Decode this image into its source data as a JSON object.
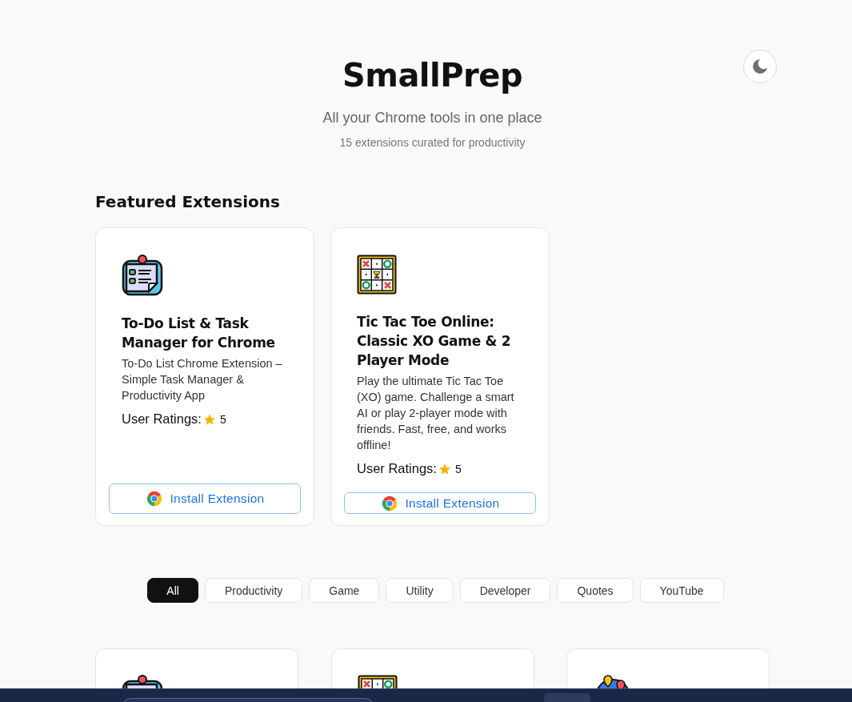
{
  "header": {
    "title": "SmallPrep",
    "subtitle": "All your Chrome tools in one place",
    "count": "15 extensions curated for productivity"
  },
  "featured": {
    "heading": "Featured Extensions",
    "cards": [
      {
        "kind": "todo",
        "title": "To-Do List & Task Manager for Chrome",
        "description": "To-Do List Chrome Extension – Simple Task Manager & Productivity App",
        "ratings_label": "User Ratings:",
        "rating": "5",
        "button": "Install Extension"
      },
      {
        "kind": "tictactoe",
        "title": "Tic Tac Toe Online: Classic XO Game & 2 Player Mode",
        "description": "Play the ultimate Tic Tac Toe (XO) game. Challenge a smart AI or play 2-player mode with friends. Fast, free, and works offline!",
        "ratings_label": "User Ratings:",
        "rating": "5",
        "button": "Install Extension"
      }
    ]
  },
  "filters": [
    {
      "label": "All",
      "selected": true
    },
    {
      "label": "Productivity",
      "selected": false
    },
    {
      "label": "Game",
      "selected": false
    },
    {
      "label": "Utility",
      "selected": false
    },
    {
      "label": "Developer",
      "selected": false
    },
    {
      "label": "Quotes",
      "selected": false
    },
    {
      "label": "YouTube",
      "selected": false
    }
  ],
  "grid": [
    {
      "kind": "todo"
    },
    {
      "kind": "tictactoe"
    },
    {
      "kind": "globe"
    }
  ]
}
